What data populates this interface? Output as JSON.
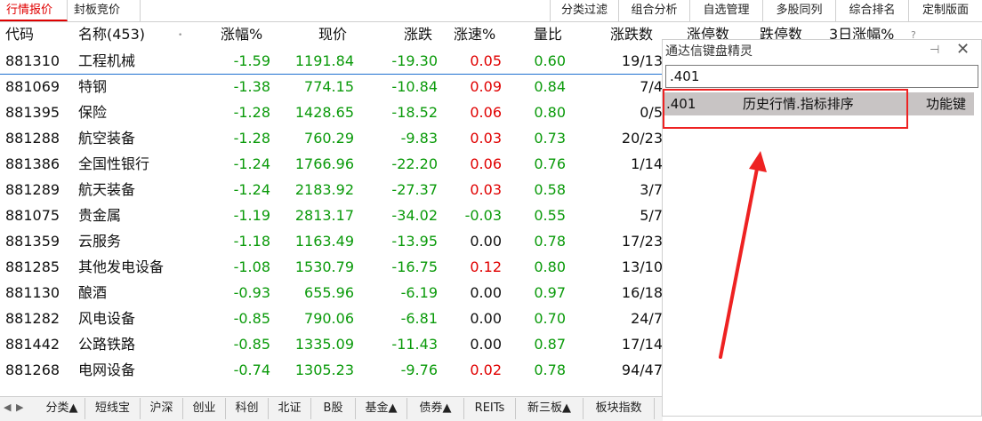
{
  "top_tabs": [
    "行情报价",
    "封板竞价"
  ],
  "right_tabs": [
    "分类过滤",
    "组合分析",
    "自选管理",
    "多股同列",
    "综合排名",
    "定制版面"
  ],
  "columns": [
    "代码",
    "名称(453)",
    "涨幅%",
    "现价",
    "涨跌",
    "涨速%",
    "量比",
    "涨跌数",
    "涨停数",
    "跌停数",
    "3日涨幅%"
  ],
  "help_glyph": "?",
  "rows": [
    {
      "code": "881310",
      "name": "工程机械",
      "pct": "-1.59",
      "price": "1191.84",
      "chg": "-19.30",
      "spd": "0.05",
      "spd_color": "red",
      "vr": "0.60",
      "ud": "19/13"
    },
    {
      "code": "881069",
      "name": "特钢",
      "pct": "-1.38",
      "price": "774.15",
      "chg": "-10.84",
      "spd": "0.09",
      "spd_color": "red",
      "vr": "0.84",
      "ud": "7/4"
    },
    {
      "code": "881395",
      "name": "保险",
      "pct": "-1.28",
      "price": "1428.65",
      "chg": "-18.52",
      "spd": "0.06",
      "spd_color": "red",
      "vr": "0.80",
      "ud": "0/5"
    },
    {
      "code": "881288",
      "name": "航空装备",
      "pct": "-1.28",
      "price": "760.29",
      "chg": "-9.83",
      "spd": "0.03",
      "spd_color": "red",
      "vr": "0.73",
      "ud": "20/23"
    },
    {
      "code": "881386",
      "name": "全国性银行",
      "pct": "-1.24",
      "price": "1766.96",
      "chg": "-22.20",
      "spd": "0.06",
      "spd_color": "red",
      "vr": "0.76",
      "ud": "1/14"
    },
    {
      "code": "881289",
      "name": "航天装备",
      "pct": "-1.24",
      "price": "2183.92",
      "chg": "-27.37",
      "spd": "0.03",
      "spd_color": "red",
      "vr": "0.58",
      "ud": "3/7"
    },
    {
      "code": "881075",
      "name": "贵金属",
      "pct": "-1.19",
      "price": "2813.17",
      "chg": "-34.02",
      "spd": "-0.03",
      "spd_color": "green",
      "vr": "0.55",
      "ud": "5/7"
    },
    {
      "code": "881359",
      "name": "云服务",
      "pct": "-1.18",
      "price": "1163.49",
      "chg": "-13.95",
      "spd": "0.00",
      "spd_color": "black",
      "vr": "0.78",
      "ud": "17/23"
    },
    {
      "code": "881285",
      "name": "其他发电设备",
      "pct": "-1.08",
      "price": "1530.79",
      "chg": "-16.75",
      "spd": "0.12",
      "spd_color": "red",
      "vr": "0.80",
      "ud": "13/10"
    },
    {
      "code": "881130",
      "name": "酿酒",
      "pct": "-0.93",
      "price": "655.96",
      "chg": "-6.19",
      "spd": "0.00",
      "spd_color": "black",
      "vr": "0.97",
      "ud": "16/18"
    },
    {
      "code": "881282",
      "name": "风电设备",
      "pct": "-0.85",
      "price": "790.06",
      "chg": "-6.81",
      "spd": "0.00",
      "spd_color": "black",
      "vr": "0.70",
      "ud": "24/7"
    },
    {
      "code": "881442",
      "name": "公路铁路",
      "pct": "-0.85",
      "price": "1335.09",
      "chg": "-11.43",
      "spd": "0.00",
      "spd_color": "black",
      "vr": "0.87",
      "ud": "17/14"
    },
    {
      "code": "881268",
      "name": "电网设备",
      "pct": "-0.74",
      "price": "1305.23",
      "chg": "-9.76",
      "spd": "0.02",
      "spd_color": "red",
      "vr": "0.78",
      "ud": "94/47"
    }
  ],
  "bottom_tabs": [
    "分类▲",
    "短线宝",
    "沪深",
    "创业",
    "科创",
    "北证",
    "B股",
    "基金▲",
    "债券▲",
    "REITs",
    "新三板▲",
    "板块指数"
  ],
  "wizard": {
    "title": "通达信键盘精灵",
    "pin": "⊣",
    "close": "✕",
    "input_value": ".401",
    "result": {
      "code": ".401",
      "name": "历史行情.指标排序",
      "type": "功能键"
    }
  }
}
